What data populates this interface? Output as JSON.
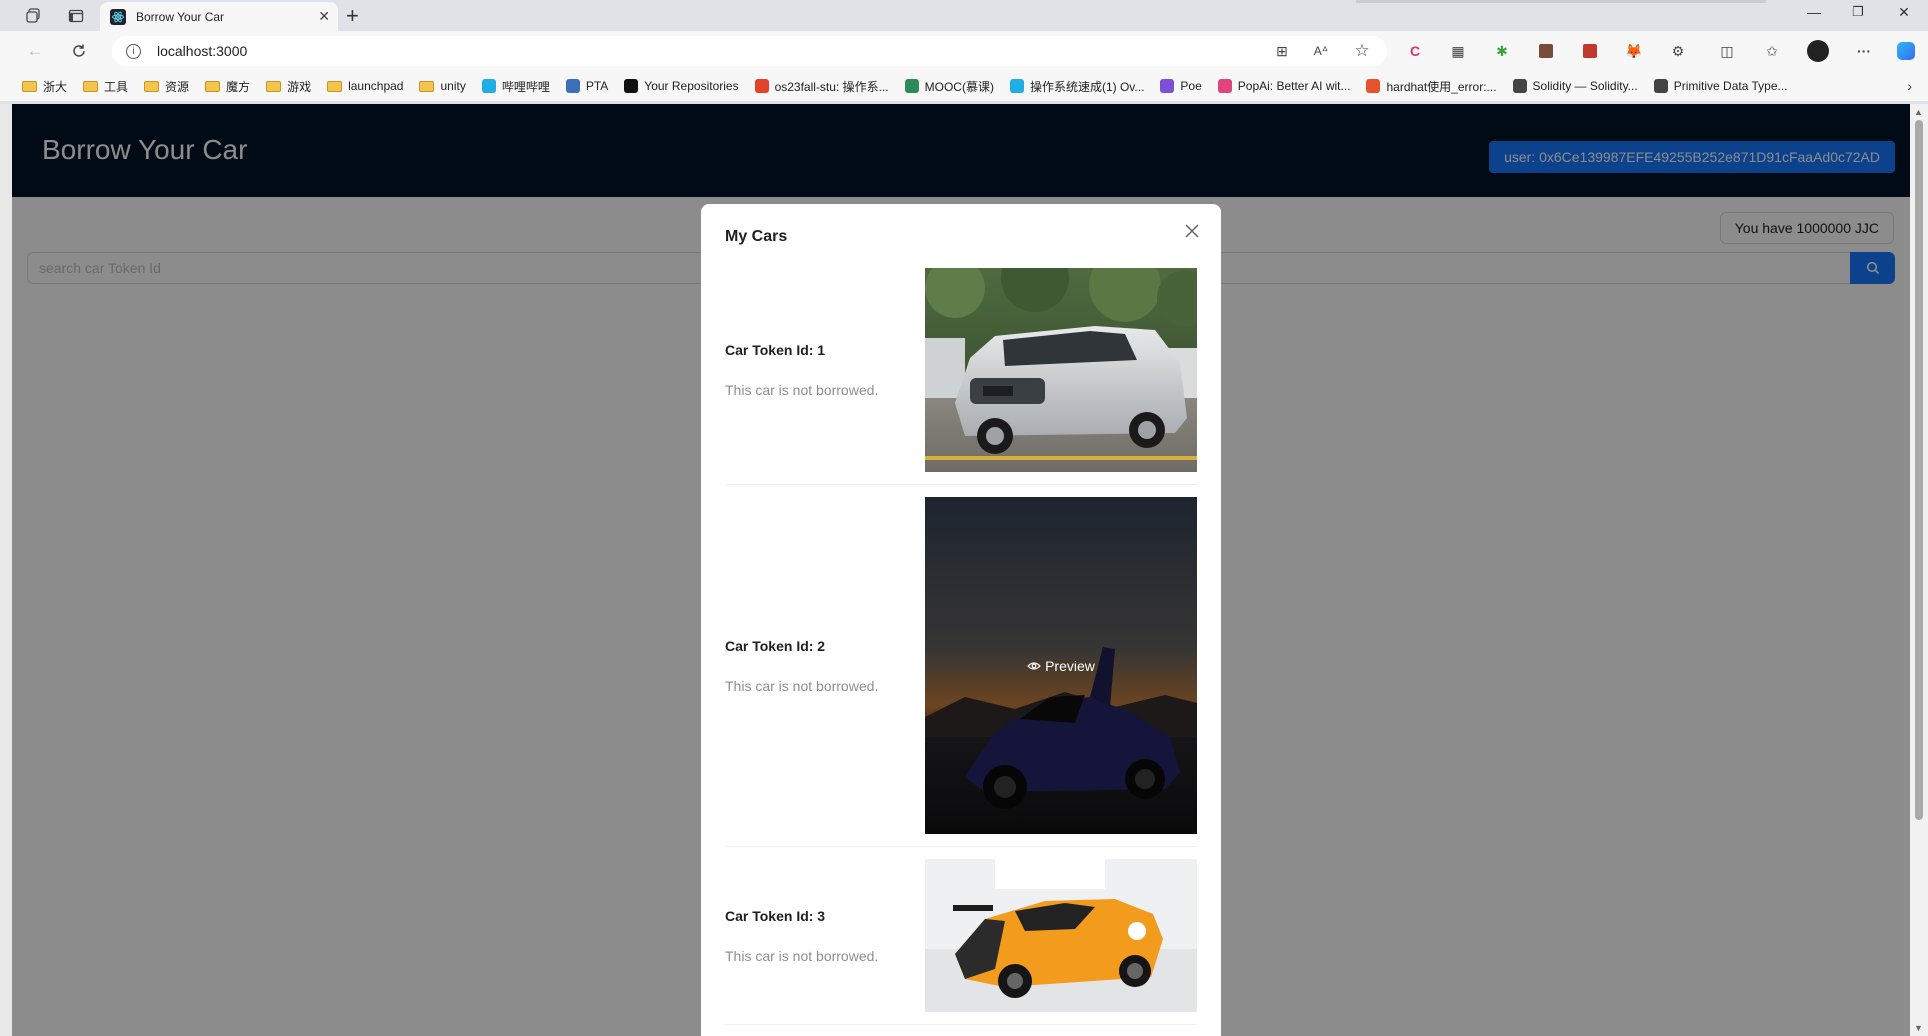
{
  "browser": {
    "tab_title": "Borrow Your Car",
    "url": "localhost:3000",
    "bookmarks": [
      {
        "label": "浙大",
        "type": "folder"
      },
      {
        "label": "工具",
        "type": "folder"
      },
      {
        "label": "资源",
        "type": "folder"
      },
      {
        "label": "魔方",
        "type": "folder"
      },
      {
        "label": "游戏",
        "type": "folder"
      },
      {
        "label": "launchpad",
        "type": "folder"
      },
      {
        "label": "unity",
        "type": "folder"
      },
      {
        "label": "哔哩哔哩",
        "type": "site",
        "color": "#23ade5"
      },
      {
        "label": "PTA",
        "type": "site",
        "color": "#3c6fb6"
      },
      {
        "label": "Your Repositories",
        "type": "site",
        "color": "#111111"
      },
      {
        "label": "os23fall-stu: 操作系...",
        "type": "site",
        "color": "#e24329"
      },
      {
        "label": "MOOC(慕课)",
        "type": "site",
        "color": "#2e8b57"
      },
      {
        "label": "操作系统速成(1) Ov...",
        "type": "site",
        "color": "#23ade5"
      },
      {
        "label": "Poe",
        "type": "site",
        "color": "#7b4fd8"
      },
      {
        "label": "PopAi: Better AI wit...",
        "type": "site",
        "color": "#e0447c"
      },
      {
        "label": "hardhat使用_error:...",
        "type": "site",
        "color": "#e5532d"
      },
      {
        "label": "Solidity — Solidity...",
        "type": "site",
        "color": "#444444"
      },
      {
        "label": "Primitive Data Type...",
        "type": "site",
        "color": "#444444"
      }
    ]
  },
  "app": {
    "title": "Borrow Your Car",
    "user_label": "user: 0x6Ce139987EFE49255B252e871D91cFaaAd0c72AD",
    "balance_label": "You have 1000000 JJC",
    "search_placeholder": "search car Token Id"
  },
  "modal": {
    "title": "My Cars",
    "cars": [
      {
        "name": "Car Token Id: 1",
        "status": "This car is not borrowed.",
        "image": "silver-minivan"
      },
      {
        "name": "Car Token Id: 2",
        "status": "This car is not borrowed.",
        "image": "purple-supercar",
        "preview_label": "Preview"
      },
      {
        "name": "Car Token Id: 3",
        "status": "This car is not borrowed.",
        "image": "orange-race-car"
      }
    ]
  },
  "colors": {
    "header_bg": "#001529",
    "primary": "#1677ff"
  }
}
